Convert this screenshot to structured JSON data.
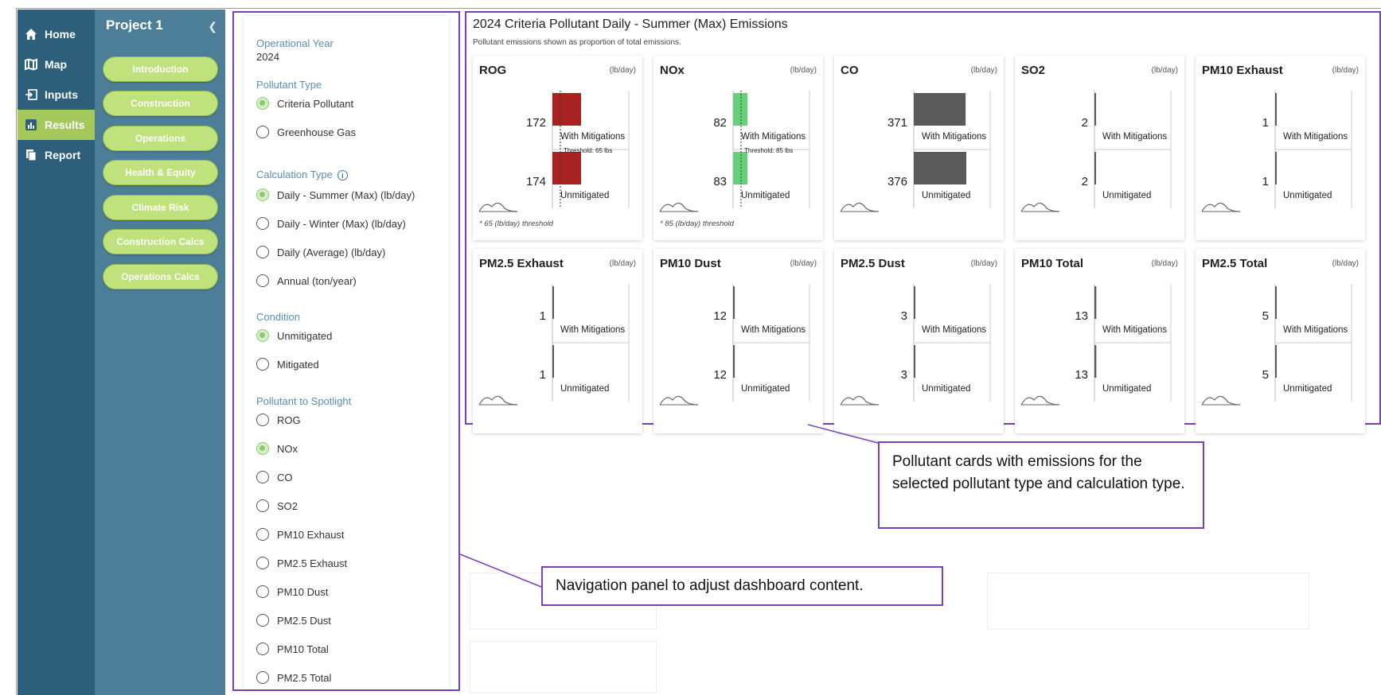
{
  "nav": {
    "items": [
      {
        "label": "Home",
        "icon": "home-icon"
      },
      {
        "label": "Map",
        "icon": "map-icon"
      },
      {
        "label": "Inputs",
        "icon": "inputs-icon"
      },
      {
        "label": "Results",
        "icon": "results-icon"
      },
      {
        "label": "Report",
        "icon": "report-icon"
      }
    ],
    "active": "Results"
  },
  "project": {
    "title": "Project 1",
    "collapse_icon": "chevron-left-icon",
    "sections": [
      "Introduction",
      "Construction",
      "Operations",
      "Health & Equity",
      "Climate Risk",
      "Construction Calcs",
      "Operations Calcs"
    ]
  },
  "panel": {
    "year_label": "Operational Year",
    "year_value": "2024",
    "pollutant_type_label": "Pollutant Type",
    "pollutant_types": [
      "Criteria Pollutant",
      "Greenhouse Gas"
    ],
    "pollutant_type_selected": "Criteria Pollutant",
    "calc_type_label": "Calculation Type",
    "calc_types": [
      "Daily - Summer (Max) (lb/day)",
      "Daily - Winter (Max) (lb/day)",
      "Daily (Average) (lb/day)",
      "Annual (ton/year)"
    ],
    "calc_type_selected": "Daily - Summer (Max) (lb/day)",
    "condition_label": "Condition",
    "conditions": [
      "Unmitigated",
      "Mitigated"
    ],
    "condition_selected": "Unmitigated",
    "spotlight_label": "Pollutant to Spotlight",
    "spotlight": [
      "ROG",
      "NOx",
      "CO",
      "SO2",
      "PM10 Exhaust",
      "PM2.5 Exhaust",
      "PM10 Dust",
      "PM2.5 Dust",
      "PM10 Total",
      "PM2.5 Total"
    ],
    "spotlight_selected": "NOx"
  },
  "dashboard": {
    "title": "2024 Criteria Pollutant Daily - Summer (Max) Emissions",
    "subtitle": "Pollutant emissions shown as proportion of total emissions.",
    "row_labels": {
      "mitigated": "With Mitigations",
      "unmitigated": "Unmitigated"
    },
    "cards": [
      {
        "name": "ROG",
        "unit": "(lb/day)",
        "mitigated": 172,
        "unmitigated": 174,
        "color": "#a82222",
        "threshold_label": "Threshold: 65 lbs",
        "note": "* 65 (lb/day) threshold"
      },
      {
        "name": "NOx",
        "unit": "(lb/day)",
        "mitigated": 82,
        "unmitigated": 83,
        "color": "#66d17a",
        "threshold_label": "Threshold: 85 lbs",
        "note": "* 85 (lb/day) threshold"
      },
      {
        "name": "CO",
        "unit": "(lb/day)",
        "mitigated": 371,
        "unmitigated": 376,
        "color": "#5a5a5a",
        "threshold_label": "",
        "note": ""
      },
      {
        "name": "SO2",
        "unit": "(lb/day)",
        "mitigated": 2,
        "unmitigated": 2,
        "color": "#5a5a5a",
        "threshold_label": "",
        "note": ""
      },
      {
        "name": "PM10 Exhaust",
        "unit": "(lb/day)",
        "mitigated": 1,
        "unmitigated": 1,
        "color": "#5a5a5a",
        "threshold_label": "",
        "note": ""
      },
      {
        "name": "PM2.5 Exhaust",
        "unit": "(lb/day)",
        "mitigated": 1,
        "unmitigated": 1,
        "color": "#5a5a5a",
        "threshold_label": "",
        "note": ""
      },
      {
        "name": "PM10 Dust",
        "unit": "(lb/day)",
        "mitigated": 12,
        "unmitigated": 12,
        "color": "#5a5a5a",
        "threshold_label": "",
        "note": ""
      },
      {
        "name": "PM2.5 Dust",
        "unit": "(lb/day)",
        "mitigated": 3,
        "unmitigated": 3,
        "color": "#5a5a5a",
        "threshold_label": "",
        "note": ""
      },
      {
        "name": "PM10 Total",
        "unit": "(lb/day)",
        "mitigated": 13,
        "unmitigated": 13,
        "color": "#5a5a5a",
        "threshold_label": "",
        "note": ""
      },
      {
        "name": "PM2.5 Total",
        "unit": "(lb/day)",
        "mitigated": 5,
        "unmitigated": 5,
        "color": "#5a5a5a",
        "threshold_label": "",
        "note": ""
      }
    ]
  },
  "callouts": {
    "cards": "Pollutant cards with emissions for the selected pollutant type and calculation type.",
    "panel": "Navigation panel to adjust dashboard content."
  }
}
